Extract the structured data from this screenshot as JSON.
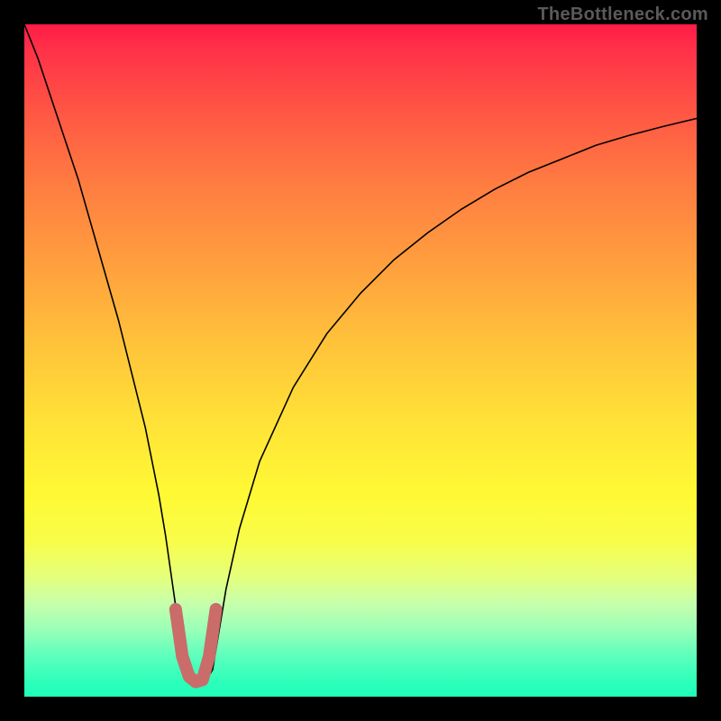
{
  "watermark": "TheBottleneck.com",
  "chart_data": {
    "type": "line",
    "title": "",
    "xlabel": "",
    "ylabel": "",
    "xlim": [
      0,
      100
    ],
    "ylim": [
      0,
      100
    ],
    "series": [
      {
        "name": "main-curve",
        "x": [
          0,
          2,
          4,
          6,
          8,
          10,
          12,
          14,
          16,
          18,
          20,
          21,
          22,
          23,
          24,
          25,
          26,
          27,
          28,
          29,
          30,
          32,
          35,
          40,
          45,
          50,
          55,
          60,
          65,
          70,
          75,
          80,
          85,
          90,
          95,
          100
        ],
        "y": [
          100,
          95,
          89,
          83,
          77,
          70,
          63,
          56,
          48,
          40,
          30,
          24,
          17,
          10,
          4,
          2.5,
          2.2,
          2.4,
          4,
          10,
          16,
          25,
          35,
          46,
          54,
          60,
          65,
          69,
          72.5,
          75.5,
          78,
          80,
          82,
          83.5,
          84.8,
          86
        ]
      },
      {
        "name": "highlight-segment",
        "x": [
          22.5,
          23.5,
          24.5,
          25.5,
          26.5,
          27.5,
          28.5
        ],
        "y": [
          13,
          6,
          3,
          2.2,
          2.5,
          6,
          13
        ],
        "color": "#c96c6a",
        "thickness": 10
      }
    ]
  }
}
